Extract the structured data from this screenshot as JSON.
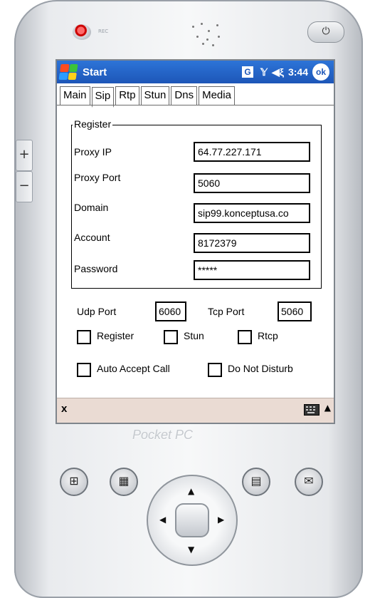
{
  "device": {
    "rec_label": "REC",
    "brand_label": "Pocket PC",
    "side_plus": "+",
    "side_minus": "−",
    "power_icon": "power-icon"
  },
  "titlebar": {
    "title": "Start",
    "g_icon": "G",
    "time": "3:44",
    "ok_label": "ok",
    "signal_icon": "signal-icon",
    "volume_icon": "volume-icon"
  },
  "tabs": [
    {
      "label": "Main",
      "active": false
    },
    {
      "label": "Sip",
      "active": true
    },
    {
      "label": "Rtp",
      "active": false
    },
    {
      "label": "Stun",
      "active": false
    },
    {
      "label": "Dns",
      "active": false
    },
    {
      "label": "Media",
      "active": false
    }
  ],
  "register": {
    "legend": "Register",
    "proxy_ip_label": "Proxy IP",
    "proxy_ip_value": "64.77.227.171",
    "proxy_port_label": "Proxy Port",
    "proxy_port_value": "5060",
    "domain_label": "Domain",
    "domain_value": "sip99.konceptusa.co",
    "account_label": "Account",
    "account_value": "8172379",
    "password_label": "Password",
    "password_value": "*****"
  },
  "ports": {
    "udp_label": "Udp Port",
    "udp_value": "6060",
    "tcp_label": "Tcp Port",
    "tcp_value": "5060"
  },
  "checkboxes": {
    "register": "Register",
    "stun": "Stun",
    "rtcp": "Rtcp",
    "auto_accept": "Auto Accept Call",
    "do_not_disturb": "Do Not Disturb"
  },
  "bottombar": {
    "close_label": "x",
    "keyboard_icon": "keyboard-icon",
    "arrow": "▲"
  },
  "colors": {
    "titlebar": "#1d56b8",
    "bottombar": "#eadbd3"
  }
}
